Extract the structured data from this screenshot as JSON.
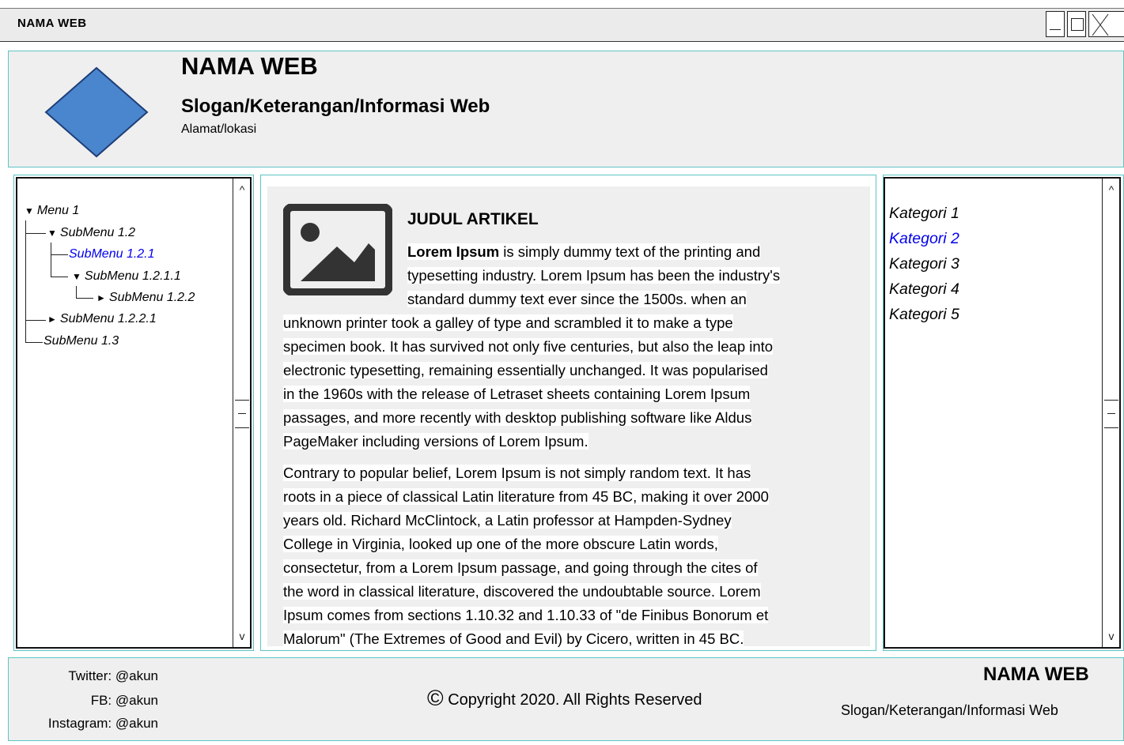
{
  "window": {
    "title": "NAMA WEB"
  },
  "header": {
    "site_name": "NAMA WEB",
    "slogan": "Slogan/Keterangan/Informasi Web",
    "address": "Alamat/lokasi",
    "logo_color": "#4a86cd"
  },
  "menu": {
    "items": [
      {
        "label": "Menu 1",
        "arrow": "▼"
      },
      {
        "label": "SubMenu 1.2",
        "arrow": "▼"
      },
      {
        "label": "SubMenu 1.2.1",
        "arrow": ""
      },
      {
        "label": "SubMenu 1.2.1.1",
        "arrow": "▼"
      },
      {
        "label": "SubMenu 1.2.2",
        "arrow": "►"
      },
      {
        "label": "SubMenu 1.2.2.1",
        "arrow": "►"
      },
      {
        "label": "SubMenu 1.3",
        "arrow": ""
      }
    ],
    "selected_color": "#0000ee"
  },
  "article": {
    "title": "JUDUL ARTIKEL",
    "lead": "Lorem Ipsum",
    "p1_lines": [
      " is simply dummy text of the printing and",
      "typesetting industry. Lorem Ipsum has been the industry's",
      "standard dummy text ever since the 1500s. when an",
      "unknown printer took a galley of type and scrambled it to make a type",
      "specimen book. It has survived not only five centuries, but also the leap into",
      "electronic typesetting, remaining essentially unchanged. It was popularised",
      "in the 1960s with the release of Letraset sheets containing Lorem Ipsum",
      "passages, and more recently with desktop publishing software like Aldus",
      "PageMaker including versions of Lorem Ipsum."
    ],
    "p2_lines": [
      "Contrary to popular belief, Lorem Ipsum is not simply random text. It has",
      "roots in a piece of classical Latin literature from 45 BC, making it over 2000",
      "years old. Richard McClintock, a Latin professor at Hampden-Sydney",
      "College in Virginia, looked up one of the more obscure Latin words,",
      "consectetur, from a Lorem Ipsum passage, and going through the cites of",
      "the word in classical literature, discovered the undoubtable source. Lorem",
      "Ipsum comes from sections 1.10.32 and 1.10.33 of \"de Finibus Bonorum et",
      "Malorum\" (The Extremes of Good and Evil) by Cicero, written in 45 BC."
    ]
  },
  "categories": {
    "items": [
      "Kategori 1",
      "Kategori 2",
      "Kategori 3",
      "Kategori 4",
      "Kategori 5"
    ],
    "selected_color": "#0000ee"
  },
  "footer": {
    "twitter": "Twitter: @akun",
    "facebook": "FB: @akun",
    "instagram": "Instagram: @akun",
    "copyright_symbol": "©",
    "copyright": "Copyright 2020. All Rights Reserved",
    "site_name": "NAMA WEB",
    "slogan": "Slogan/Keterangan/Informasi Web"
  }
}
